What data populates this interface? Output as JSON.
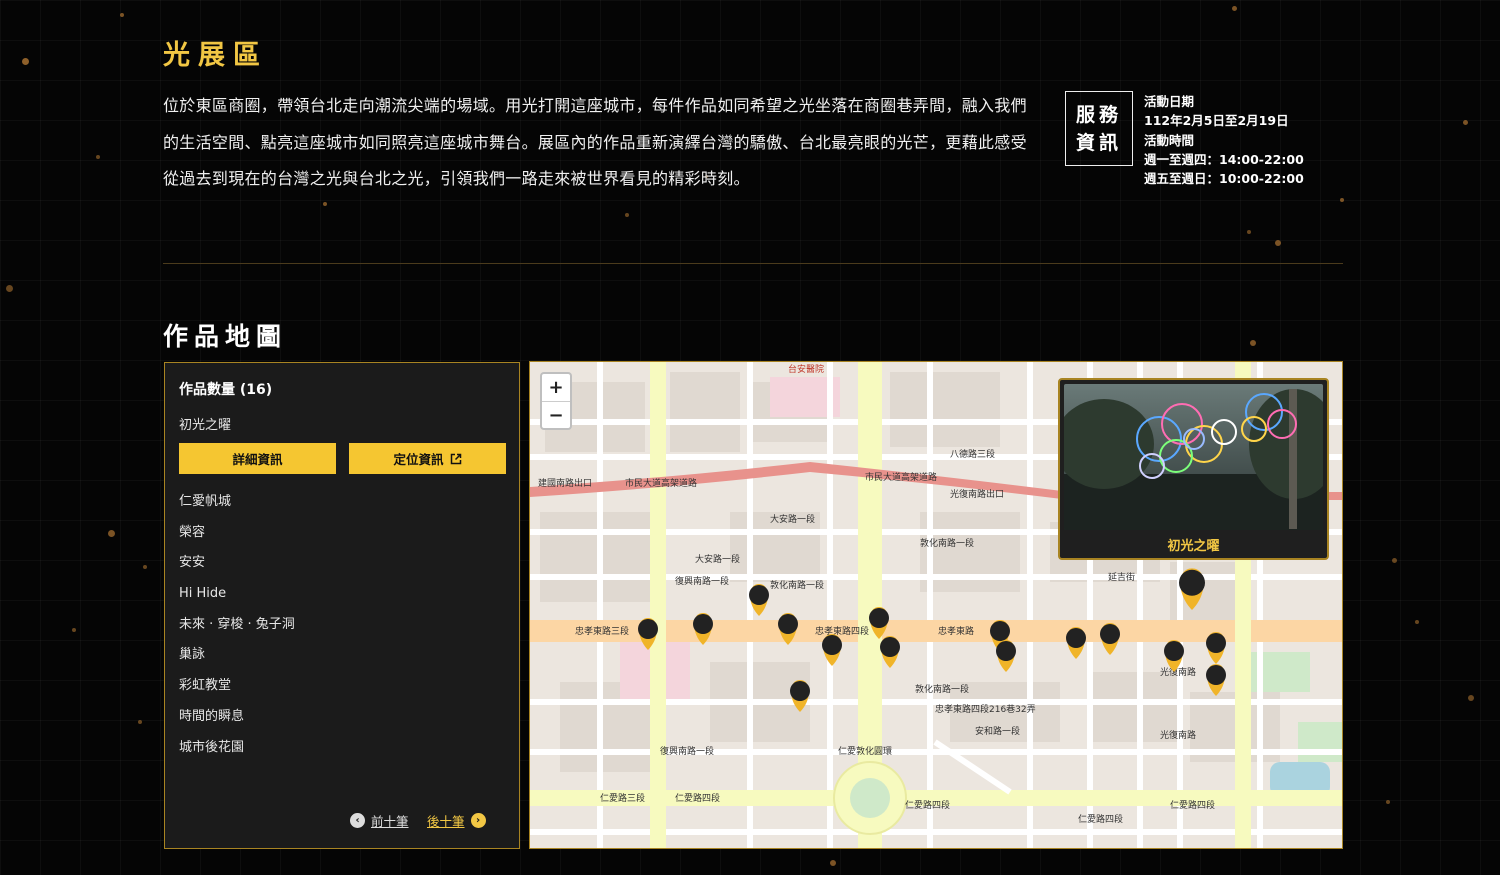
{
  "exhibition": {
    "title": "光展區",
    "intro": "位於東區商圈，帶領台北走向潮流尖端的場域。用光打開這座城市，每件作品如同希望之光坐落在商圈巷弄間，融入我們的生活空間、點亮這座城市如同照亮這座城市舞台。展區內的作品重新演繹台灣的驕傲、台北最亮眼的光芒，更藉此感受從過去到現在的台灣之光與台北之光，引領我們一路走來被世界看見的精彩時刻。"
  },
  "service": {
    "box_line1": "服務",
    "box_line2": "資訊",
    "date_label": "活動日期",
    "date_value": "112年2月5日至2月19日",
    "time_label": "活動時間",
    "time_weekday": "週一至週四：14:00-22:00",
    "time_weekend": "週五至週日：10:00-22:00"
  },
  "artwork_map": {
    "title": "作品地圖",
    "count_label": "作品數量 (16)",
    "selected_name": "初光之曜",
    "detail_button": "詳細資訊",
    "locate_button": "定位資訊",
    "items": [
      "仁愛帆城",
      "榮容",
      "安安",
      "Hi Hide",
      "未來 · 穿梭 · 兔子洞",
      "巢詠",
      "彩虹教堂",
      "時間的瞬息",
      "城市後花園"
    ],
    "prev_label": "前十筆",
    "next_label": "後十筆"
  },
  "map": {
    "zoom_in": "+",
    "zoom_out": "−",
    "popup_caption": "初光之曜",
    "streets": {
      "civic_blvd": "市民大道高架道路",
      "jianguo": "建國南路出口",
      "guangfu_exit": "光復南路出口",
      "zhongxiao_3": "忠孝東路三段",
      "zhongxiao_4": "忠孝東路四段",
      "renai_3": "仁愛路三段",
      "renai_4": "仁愛路四段",
      "renai_circle": "仁愛敦化圓環",
      "dunhua_s": "敦化南路一段",
      "daan_rd": "大安路一段",
      "fuxing_s": "復興南路一段",
      "zhongxiao_f": "忠孝東路",
      "guangfu_s": "光復南路",
      "anhe": "安和路一段",
      "yanji": "延吉街",
      "bade": "八德路三段",
      "hospital": "台安醫院",
      "sec4_237": "忠孝東路四段216巷32弄"
    }
  },
  "colors": {
    "accent": "#f2c744",
    "button": "#f5c631",
    "border": "#a88422",
    "marker": "#f0b429"
  }
}
